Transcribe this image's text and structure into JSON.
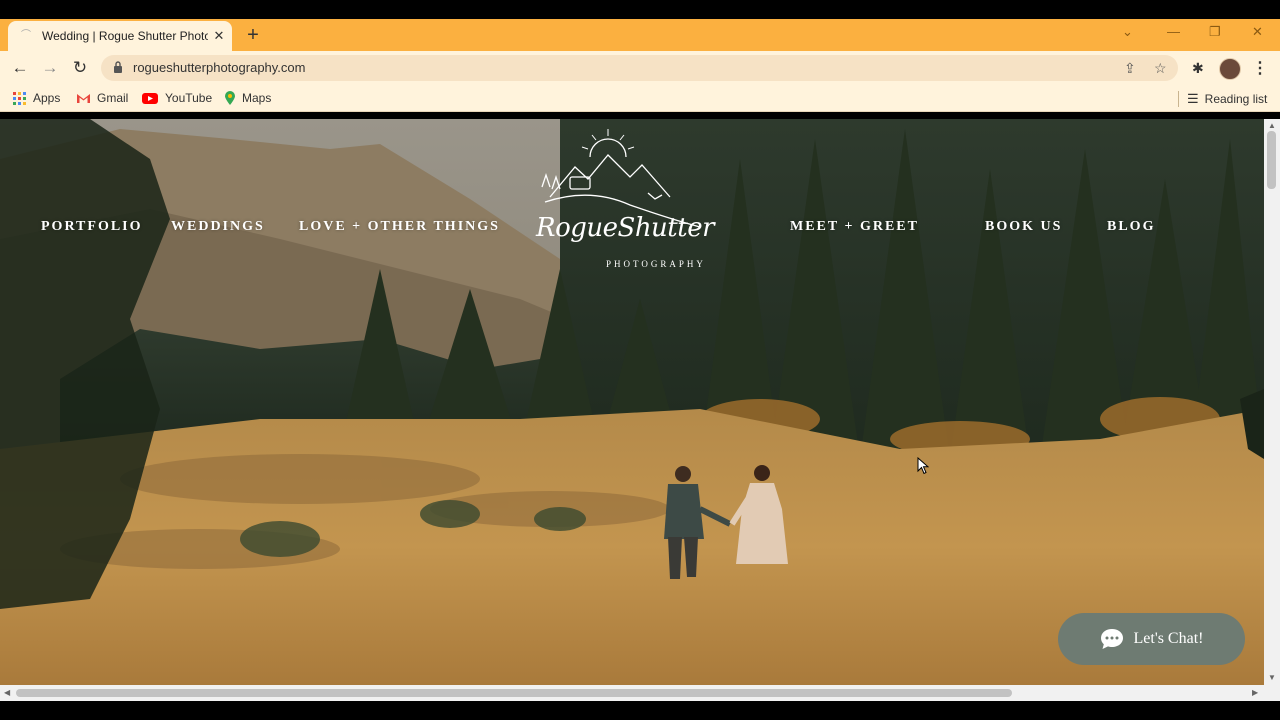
{
  "browser": {
    "tab": {
      "title": "Wedding | Rogue Shutter Photog"
    },
    "url": "rogueshutterphotography.com",
    "bookmarks": [
      {
        "label": "Apps",
        "icon": "apps-grid-icon"
      },
      {
        "label": "Gmail",
        "icon": "gmail-icon"
      },
      {
        "label": "YouTube",
        "icon": "youtube-icon"
      },
      {
        "label": "Maps",
        "icon": "maps-icon"
      }
    ],
    "reading_list": "Reading list"
  },
  "site": {
    "nav": {
      "portfolio": "PORTFOLIO",
      "weddings": "WEDDINGS",
      "love": "LOVE + OTHER THINGS",
      "meet": "MEET + GREET",
      "book": "BOOK US",
      "blog": "BLOG"
    },
    "logo": {
      "script": "RogueShutter",
      "sub": "PHOTOGRAPHY"
    },
    "chat_label": "Let's Chat!"
  },
  "colors": {
    "tabstrip": "#fbb040",
    "toolbar": "#fff3dc",
    "chat_button": "#6e7b72"
  }
}
